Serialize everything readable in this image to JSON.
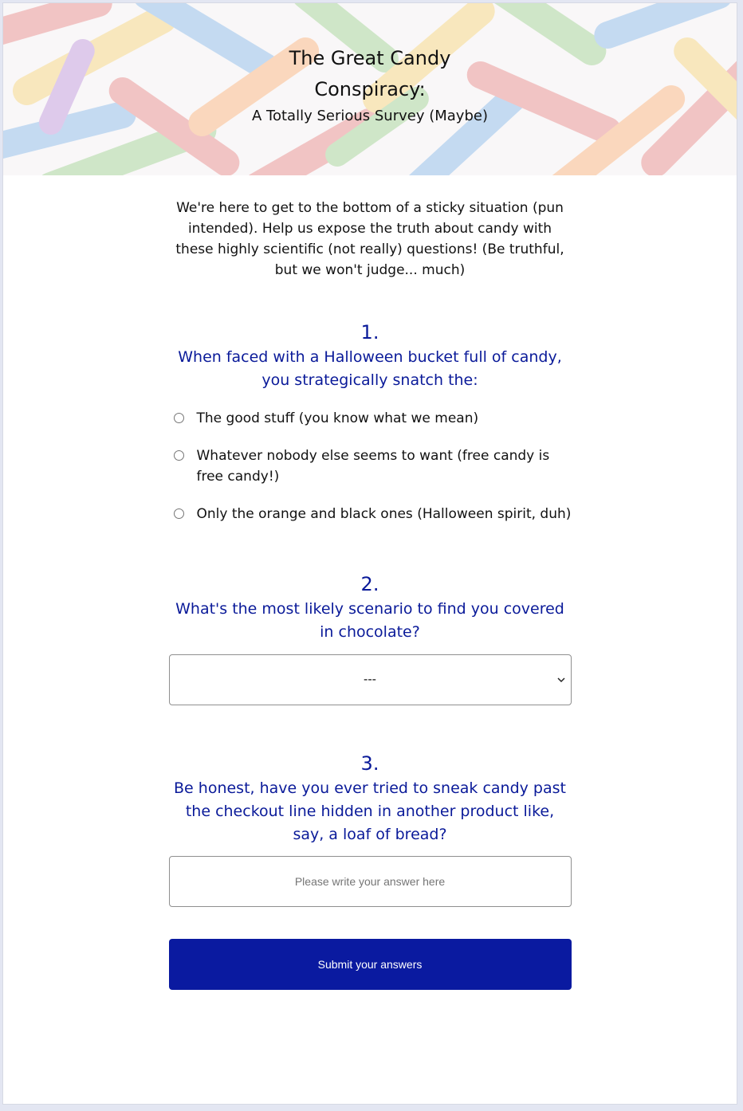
{
  "header": {
    "title": "The Great Candy Conspiracy:",
    "subtitle": "A Totally Serious Survey (Maybe)"
  },
  "intro": "We're here to get to the bottom of a sticky situation (pun intended). Help us expose the truth about candy with these highly scientific (not really) questions! (Be truthful, but we won't judge... much)",
  "questions": [
    {
      "number": "1.",
      "text": "When faced with a Halloween bucket full of candy, you strategically snatch the:",
      "options": [
        "The good stuff (you know what we mean)",
        "Whatever nobody else seems to want (free candy is free candy!)",
        "Only the orange and black ones (Halloween spirit, duh)"
      ]
    },
    {
      "number": "2.",
      "text": "What's the most likely scenario to find you covered in chocolate?",
      "select_value": "---"
    },
    {
      "number": "3.",
      "text": "Be honest, have you ever tried to sneak candy past the checkout line hidden in another product like, say, a loaf of bread?",
      "placeholder": "Please write your answer here"
    }
  ],
  "submit_label": "Submit your answers",
  "colors": {
    "accent": "#0a1aa0",
    "question_text": "#0a1a99",
    "page_background": "#e3e6f2"
  },
  "icons": {
    "select_arrow": "chevron-down-icon"
  }
}
